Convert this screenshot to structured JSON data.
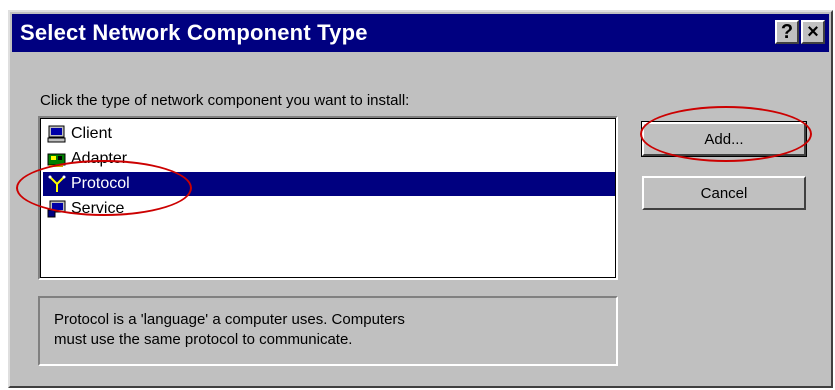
{
  "dialog": {
    "title": "Select Network Component Type",
    "help_glyph": "?",
    "close_glyph": "×"
  },
  "instruction": "Click the type of network component you want to install:",
  "components": [
    {
      "label": "Client",
      "icon": "computer-icon"
    },
    {
      "label": "Adapter",
      "icon": "network-card-icon"
    },
    {
      "label": "Protocol",
      "icon": "protocol-icon",
      "selected": true
    },
    {
      "label": "Service",
      "icon": "service-icon"
    }
  ],
  "buttons": {
    "add": "Add...",
    "cancel": "Cancel"
  },
  "description": {
    "line1": "Protocol is a 'language' a computer uses. Computers",
    "line2": "must use the same protocol to communicate."
  },
  "colors": {
    "titlebar": "#000080",
    "selection": "#000080",
    "face": "#c0c0c0",
    "annotation": "#cc0000"
  }
}
